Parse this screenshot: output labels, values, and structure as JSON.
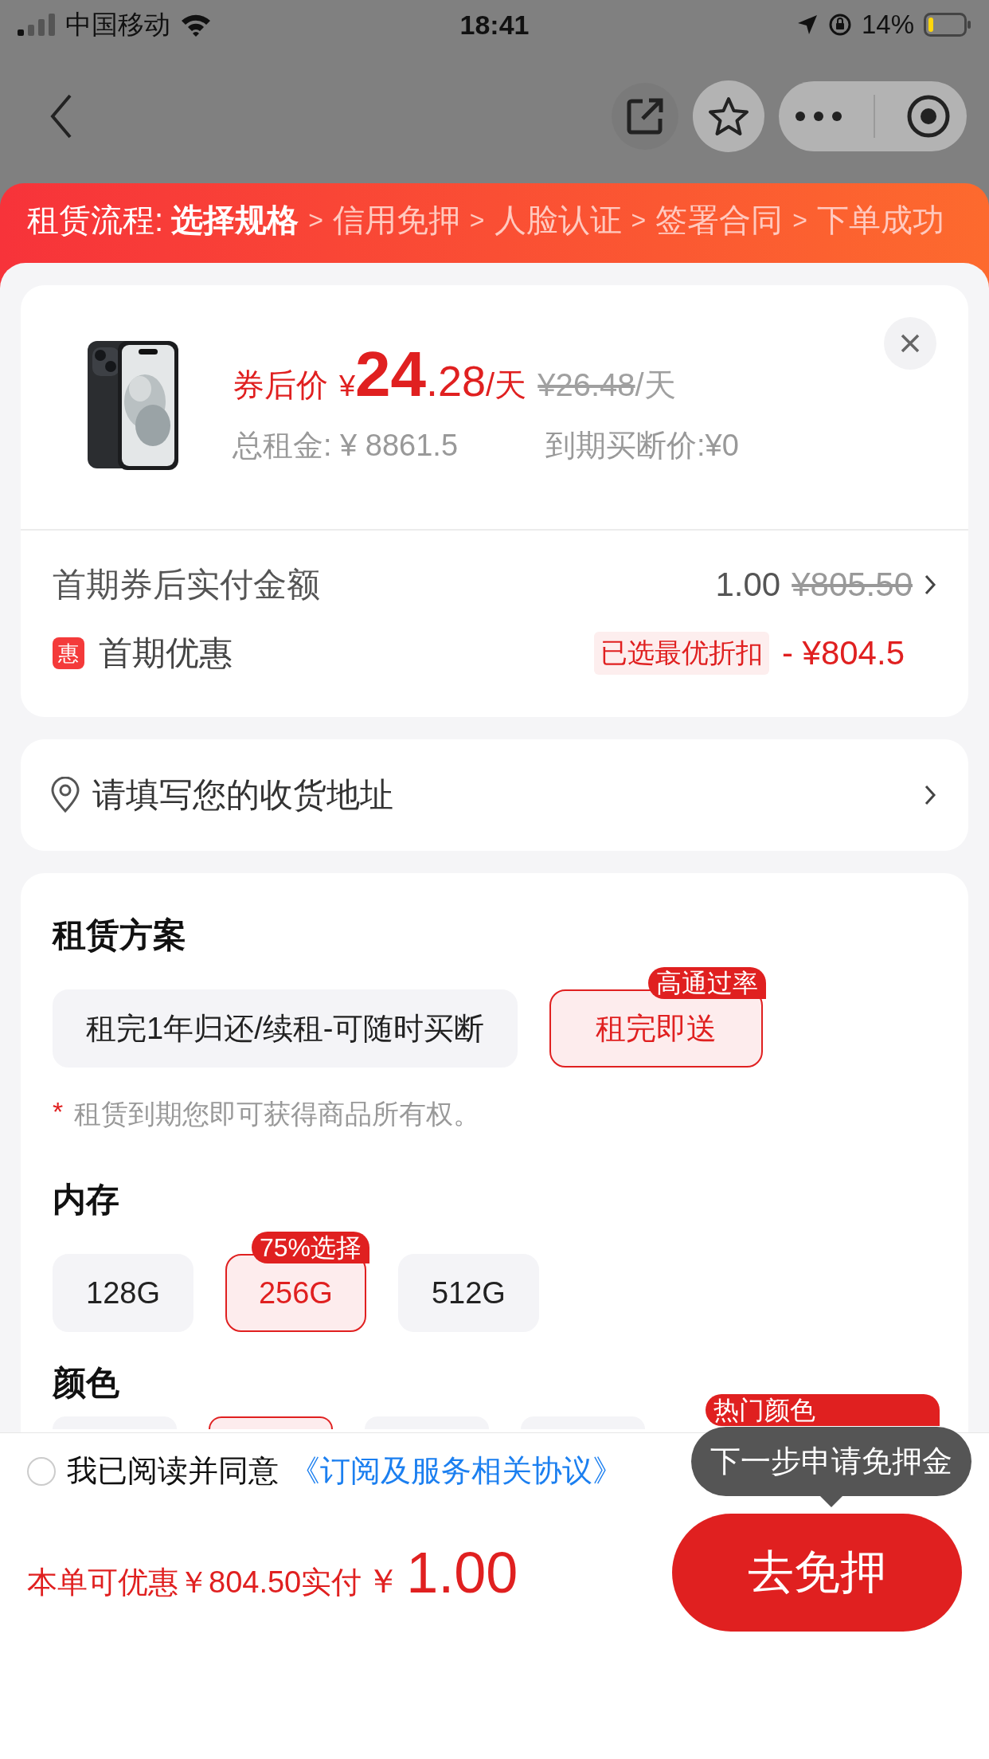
{
  "status_bar": {
    "carrier": "中国移动",
    "time": "18:41",
    "battery": "14%"
  },
  "progress": {
    "label": "租赁流程:",
    "separator": ">",
    "steps": [
      {
        "label": "选择规格",
        "current": true
      },
      {
        "label": "信用免押",
        "current": false
      },
      {
        "label": "人脸认证",
        "current": false
      },
      {
        "label": "签署合同",
        "current": false
      },
      {
        "label": "下单成功",
        "current": false
      }
    ]
  },
  "product": {
    "price_label": "券后价",
    "currency": "¥",
    "price_int": "24",
    "price_dec": ".28",
    "unit": "/天",
    "old_price": "¥26.48",
    "old_unit": "/天",
    "total": "总租金: ¥ 8861.5",
    "buyout": "到期买断价:¥0"
  },
  "first_payment": {
    "label": "首期券后实付金额",
    "amount": "1.00",
    "original": "¥805.50"
  },
  "discount": {
    "icon": "惠",
    "label": "首期优惠",
    "tag": "已选最优折扣",
    "amount": "- ¥804.5"
  },
  "address": {
    "label": "请填写您的收货地址"
  },
  "sections": [
    {
      "title": "租赁方案",
      "options": [
        {
          "label": "租完1年归还/续租-可随时买断",
          "selected": false
        },
        {
          "label": "租完即送",
          "selected": true,
          "badge": "高通过率"
        }
      ],
      "note": {
        "mark": "*",
        "text": "租赁到期您即可获得商品所有权。"
      }
    },
    {
      "title": "内存",
      "options": [
        {
          "label": "128G",
          "selected": false
        },
        {
          "label": "256G",
          "selected": true,
          "badge": "75%选择"
        },
        {
          "label": "512G",
          "selected": false
        }
      ]
    },
    {
      "title": "颜色",
      "options": [
        {
          "selected": false
        },
        {
          "selected": true
        },
        {
          "selected": false
        },
        {
          "selected": false
        }
      ],
      "badge": "热门颜色"
    }
  ],
  "footer": {
    "agree_checked": false,
    "agree_text": "我已阅读并同意",
    "agree_link": "《订阅及服务相关协议》",
    "summary": "本单可优惠￥804.50实付",
    "currency": "￥",
    "amount": "1.00",
    "tooltip": "下一步申请免押金",
    "button": "去免押"
  }
}
